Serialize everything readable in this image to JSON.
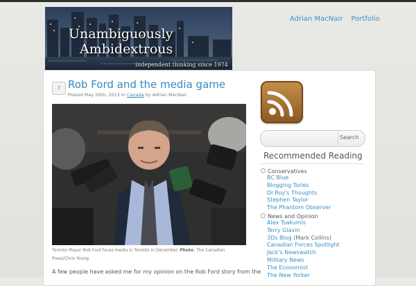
{
  "header": {
    "title_line1": "Unambiguously",
    "title_line2": "Ambidextrous",
    "tagline": "independent thinking since 1974"
  },
  "nav": {
    "items": [
      "Adrian MacNair",
      "Portfolio"
    ]
  },
  "post": {
    "date_icon": "7",
    "title": "Rob Ford and the media game",
    "meta_prefix": "Posted May 26th, 2013 in",
    "category": "Canada",
    "meta_suffix": "by Adrian MacNair",
    "photo_caption": "Toronto Mayor Rob Ford faces media in Toronto in December.",
    "photo_credit_label": "Photo",
    "photo_credit": ": The Canadian Press/Chris Young",
    "excerpt": "A few people have asked me for my opinion on the Rob Ford story from the"
  },
  "sidebar": {
    "rss_icon": "rss-feed-icon",
    "search_button": "Search",
    "search_value": "",
    "recommended_title": "Recommended Reading",
    "categories": [
      {
        "name": "Conservatives",
        "links": [
          "BC Blue",
          "Blogging Tories",
          "Dr.Roy's Thoughts",
          "Stephen Taylor",
          "The Phantom Observer"
        ]
      },
      {
        "name": "News and Opinion",
        "links": [
          "Alex Tsakumis",
          "Terry Glavin",
          "3Ds Blog",
          "Canadian Forces Spotlight",
          "Jack's Newswatch",
          "Military News",
          "The Economist",
          "The New Yorker"
        ],
        "notes": {
          "2": " (Mark Collins)"
        }
      }
    ]
  },
  "colors": {
    "link": "#3589be",
    "background": "#e9e9e6"
  }
}
